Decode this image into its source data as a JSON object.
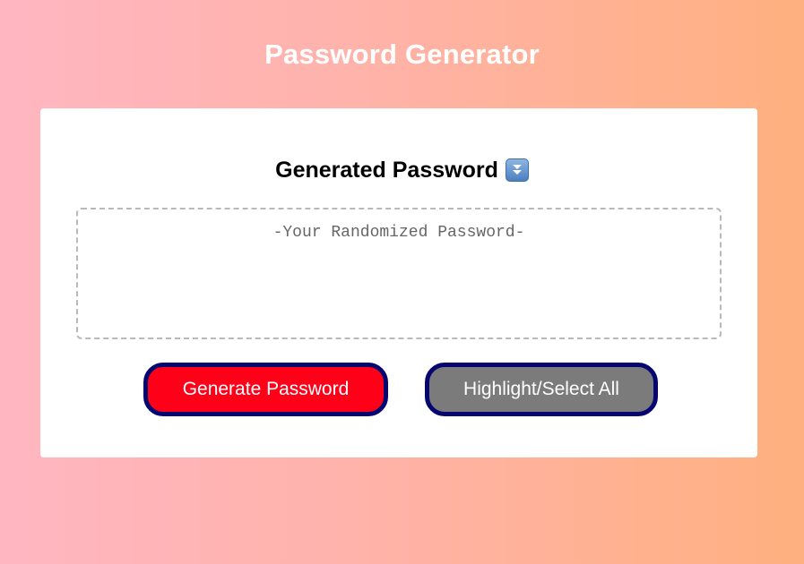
{
  "header": {
    "title": "Password Generator"
  },
  "card": {
    "title": "Generated Password",
    "title_icon": "double-down-arrow-icon",
    "password_placeholder": "-Your Randomized Password-",
    "password_value": ""
  },
  "buttons": {
    "generate_label": "Generate Password",
    "highlight_label": "Highlight/Select All"
  },
  "colors": {
    "generate_button": "#ff0019",
    "highlight_button": "#7b7b7b",
    "button_border": "#060670",
    "background_left": "#ffb6c1",
    "background_right": "#ffb07f"
  }
}
